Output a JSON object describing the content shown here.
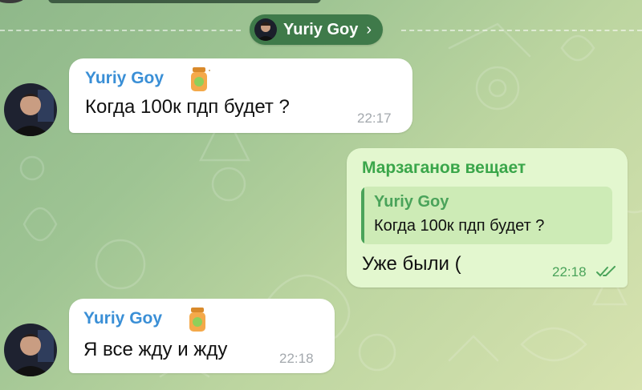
{
  "chat": {
    "header_chip": {
      "name": "Yuriy Goy"
    }
  },
  "messages": [
    {
      "sender": "Yuriy Goy",
      "text": "Когда 100к пдп будет ?",
      "time": "22:17",
      "sender_color": "#3a8fd6"
    },
    {
      "sender": "Марзаганов вещает",
      "reply_sender": "Yuriy Goy",
      "reply_text": "Когда 100к пдп будет ?",
      "text": "Уже были (",
      "time": "22:18",
      "sender_color": "#3aa64a",
      "status": "read"
    },
    {
      "sender": "Yuriy Goy",
      "text": "Я все жду и жду",
      "time": "22:18",
      "sender_color": "#3a8fd6"
    }
  ],
  "icons": [
    "avatar",
    "honey-jar-badge-icon",
    "chevron-right-icon",
    "double-check-icon"
  ]
}
